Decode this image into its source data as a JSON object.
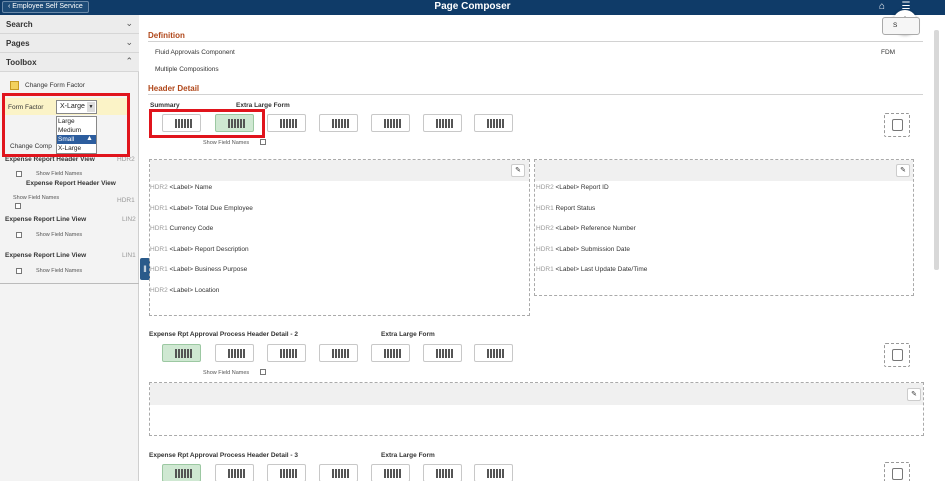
{
  "header": {
    "back_label": "Employee Self Service",
    "title": "Page Composer",
    "icons": [
      "home-icon",
      "hamburger-menu-icon",
      "more-options-icon"
    ]
  },
  "sidebar": {
    "search": "Search",
    "pages": "Pages",
    "toolbox": "Toolbox",
    "change_form_factor": "Change Form Factor",
    "form_factor_label": "Form Factor",
    "form_factor_value": "X-Large",
    "form_factor_options": [
      "Large",
      "Medium",
      "Small",
      "X-Large"
    ],
    "change_comp": "Change Comp",
    "items": [
      {
        "title": "Expense Report Header View",
        "code": "HDR2",
        "toggle": "Show Field Names"
      },
      {
        "title": "Expense Report Header View",
        "code": "HDR1",
        "toggle": "Show Field Names"
      },
      {
        "title": "Expense Report Line View",
        "code": "LIN2",
        "toggle": "Show Field Names"
      },
      {
        "title": "Expense Report Line View",
        "code": "LIN1",
        "toggle": "Show Field Names"
      }
    ]
  },
  "main": {
    "save_label": "S",
    "definition": {
      "title": "Definition",
      "component": "Fluid Approvals Component",
      "composition": "Multiple Compositions",
      "code": "FDM"
    },
    "header_detail": {
      "title": "Header Detail",
      "summary": "Summary",
      "form_label": "Extra Large Form",
      "show_field_names": "Show Field Names",
      "left": [
        {
          "p": "HDR2",
          "t": "<Label> Name"
        },
        {
          "p": "HDR1",
          "t": "<Label> Total Due Employee"
        },
        {
          "p": "HDR1",
          "t": "Currency Code"
        },
        {
          "p": "HDR1",
          "t": "<Label> Report Description"
        },
        {
          "p": "HDR1",
          "t": "<Label> Business Purpose"
        },
        {
          "p": "HDR2",
          "t": "<Label> Location"
        }
      ],
      "right": [
        {
          "p": "HDR2",
          "t": "<Label> Report ID"
        },
        {
          "p": "HDR1",
          "t": "Report Status"
        },
        {
          "p": "HDR2",
          "t": "<Label> Reference Number"
        },
        {
          "p": "HDR1",
          "t": "<Label> Submission Date"
        },
        {
          "p": "HDR1",
          "t": "<Label> Last Update Date/Time"
        }
      ]
    },
    "section2": {
      "title": "Expense Rpt Approval Process Header Detail - 2",
      "form_label": "Extra Large Form",
      "show_field_names": "Show Field Names"
    },
    "section3": {
      "title": "Expense Rpt Approval Process Header Detail - 3",
      "form_label": "Extra Large Form"
    }
  },
  "colors": {
    "header_bg": "#0f3b68",
    "section_title": "#b0471a",
    "highlight_border": "#e0141c",
    "selected_layout": "#cfe8d2"
  }
}
